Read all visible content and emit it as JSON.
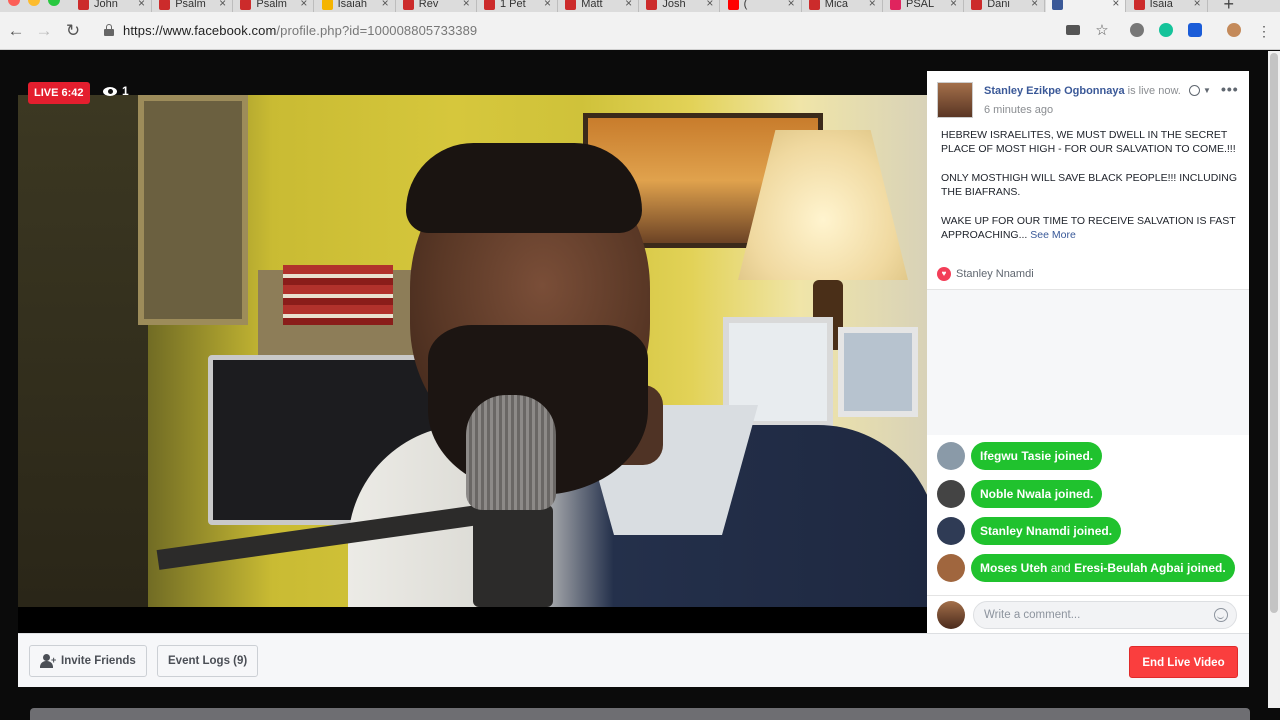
{
  "browser": {
    "tabs": [
      {
        "label": "John",
        "favicon_color": "#cc2b2b"
      },
      {
        "label": "Psalm",
        "favicon_color": "#cc2b2b"
      },
      {
        "label": "Psalm",
        "favicon_color": "#cc2b2b"
      },
      {
        "label": "Isaiah",
        "favicon_color": "#f5b400"
      },
      {
        "label": "Rev",
        "favicon_color": "#cc2b2b"
      },
      {
        "label": "1 Pet",
        "favicon_color": "#cc2b2b"
      },
      {
        "label": "Matt",
        "favicon_color": "#cc2b2b"
      },
      {
        "label": "Josh",
        "favicon_color": "#cc2b2b"
      },
      {
        "label": "(",
        "favicon_color": "#ff0000"
      },
      {
        "label": "Mica",
        "favicon_color": "#cc2b2b"
      },
      {
        "label": "PSAL",
        "favicon_color": "#e0245e"
      },
      {
        "label": "Dani",
        "favicon_color": "#cc2b2b"
      },
      {
        "label": "",
        "favicon_color": "#3b5998"
      },
      {
        "label": "Isaia",
        "favicon_color": "#cc2b2b"
      }
    ],
    "new_tab_label": "+",
    "url_base": "https://www.facebook.com",
    "url_rest": "/profile.php?id=100008805733389"
  },
  "video": {
    "live_label": "LIVE 6:42",
    "viewer_count": "1"
  },
  "post": {
    "author": "Stanley Ezikpe Ogbonnaya",
    "status": " is live now.",
    "time": "6 minutes ago",
    "paragraphs": [
      "HEBREW ISRAELITES, WE MUST DWELL IN THE SECRET PLACE OF MOST HIGH - FOR OUR SALVATION TO COME.!!!",
      "ONLY MOSTHIGH WILL SAVE BLACK PEOPLE!!! INCLUDING THE BIAFRANS.",
      "WAKE UP FOR OUR TIME TO RECEIVE SALVATION IS FAST APPROACHING..."
    ],
    "see_more": "See More",
    "reaction_by": "Stanley Nnamdi"
  },
  "joined": [
    {
      "name": "Ifegwu Tasie",
      "suffix": " joined.",
      "avatar_color": "#8a9aa8"
    },
    {
      "name": "Noble Nwala",
      "suffix": " joined.",
      "avatar_color": "#444444"
    },
    {
      "name": "Stanley Nnamdi",
      "suffix": " joined.",
      "avatar_color": "#2f3b55"
    },
    {
      "name": "Moses Uteh",
      "connector": " and ",
      "name2": "Eresi-Beulah Agbai",
      "suffix": " joined.",
      "avatar_color": "#a0663e"
    }
  ],
  "composer": {
    "placeholder": "Write a comment..."
  },
  "controls": {
    "invite_label": "Invite Friends",
    "event_logs_label": "Event Logs (9)",
    "end_live_label": "End Live Video"
  }
}
